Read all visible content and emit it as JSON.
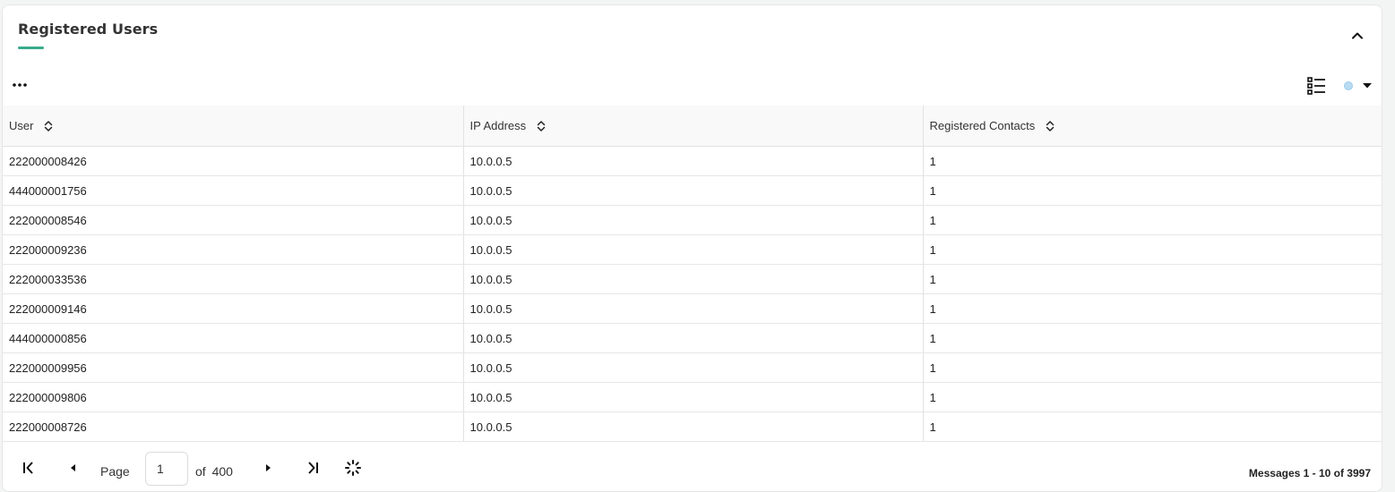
{
  "panel": {
    "title": "Registered Users",
    "accent_color": "#3aaa8c"
  },
  "toolbar": {
    "more_icon": "more-horizontal-icon",
    "list_view_icon": "list-view-icon",
    "status_indicator_color": "#b9dcf3",
    "dropdown_icon": "caret-down-icon",
    "collapse_icon": "chevron-up-icon"
  },
  "table": {
    "columns": [
      {
        "label": "User"
      },
      {
        "label": "IP Address"
      },
      {
        "label": "Registered Contacts"
      }
    ],
    "rows": [
      [
        "222000008426",
        "10.0.0.5",
        "1"
      ],
      [
        "444000001756",
        "10.0.0.5",
        "1"
      ],
      [
        "222000008546",
        "10.0.0.5",
        "1"
      ],
      [
        "222000009236",
        "10.0.0.5",
        "1"
      ],
      [
        "222000033536",
        "10.0.0.5",
        "1"
      ],
      [
        "222000009146",
        "10.0.0.5",
        "1"
      ],
      [
        "444000000856",
        "10.0.0.5",
        "1"
      ],
      [
        "222000009956",
        "10.0.0.5",
        "1"
      ],
      [
        "222000009806",
        "10.0.0.5",
        "1"
      ],
      [
        "222000008726",
        "10.0.0.5",
        "1"
      ]
    ]
  },
  "pager": {
    "page_label": "Page",
    "current_page": "1",
    "of_label": "of",
    "total_pages": "400",
    "summary": "Messages 1 - 10 of 3997"
  }
}
